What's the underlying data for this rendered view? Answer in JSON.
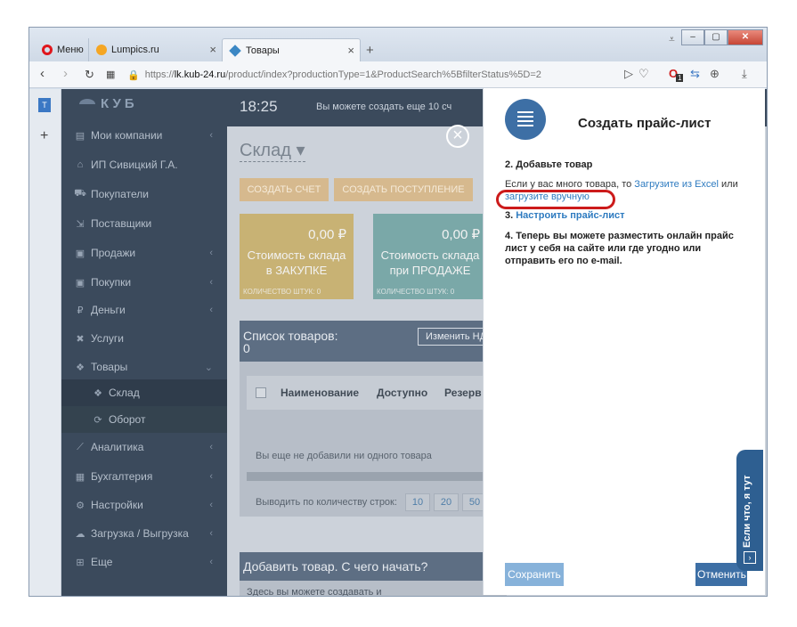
{
  "browser": {
    "tabs": [
      {
        "label": "Меню"
      },
      {
        "label": "Lumpics.ru"
      },
      {
        "label": "Товары"
      }
    ],
    "url": {
      "prefix": "https://",
      "host": "lk.kub-24.ru",
      "path": "/product/index?productionType=1&ProductSearch%5BfilterStatus%5D=2"
    },
    "badge_count": "1"
  },
  "sidebar": {
    "logo": "КУБ",
    "items": [
      {
        "label": "Мои компании",
        "icon": "briefcase-icon",
        "chevron": "‹"
      },
      {
        "label": "ИП Сивицкий Г.А.",
        "icon": "home-icon"
      },
      {
        "label": "Покупатели",
        "icon": "cart-icon"
      },
      {
        "label": "Поставщики",
        "icon": "trolley-icon"
      },
      {
        "label": "Продажи",
        "icon": "doc-icon",
        "chevron": "‹"
      },
      {
        "label": "Покупки",
        "icon": "doc-icon",
        "chevron": "‹"
      },
      {
        "label": "Деньги",
        "icon": "ruble-icon",
        "chevron": "‹"
      },
      {
        "label": "Услуги",
        "icon": "tools-icon"
      },
      {
        "label": "Товары",
        "icon": "boxes-icon",
        "chevron": "⌄"
      },
      {
        "label": "Склад",
        "icon": "boxes-icon"
      },
      {
        "label": "Оборот",
        "icon": "refresh-icon"
      },
      {
        "label": "Аналитика",
        "icon": "chart-icon",
        "chevron": "‹"
      },
      {
        "label": "Бухгалтерия",
        "icon": "ledger-icon",
        "chevron": "‹"
      },
      {
        "label": "Настройки",
        "icon": "gear-icon",
        "chevron": "‹"
      },
      {
        "label": "Загрузка / Выгрузка",
        "icon": "cloud-icon",
        "chevron": "‹"
      },
      {
        "label": "Еще",
        "icon": "plus-square-icon",
        "chevron": "‹"
      }
    ]
  },
  "topbar": {
    "time": "18:25",
    "notice": "Вы можете создать еще 10 сч"
  },
  "main": {
    "title": "Склад",
    "buttons": {
      "create_invoice": "СОЗДАТЬ СЧЕТ",
      "create_receipt": "СОЗДАТЬ ПОСТУПЛЕНИЕ"
    },
    "cards": [
      {
        "amount": "0,00 ₽",
        "line1": "Стоимость склада",
        "line2": "в ЗАКУПКЕ",
        "sub": "КОЛИЧЕСТВО ШТУК: 0"
      },
      {
        "amount": "0,00 ₽",
        "line1": "Стоимость склада",
        "line2": "при ПРОДАЖЕ",
        "sub": "КОЛИЧЕСТВО ШТУК: 0"
      }
    ],
    "list": {
      "title": "Список товаров:",
      "count": "0",
      "edit_button": "Изменить НД",
      "columns": [
        "Наименование",
        "Доступно",
        "Резерв"
      ],
      "empty": "Вы еще не добавили ни одного товара",
      "pager_label": "Выводить по количеству строк:",
      "pager": [
        "10",
        "20",
        "50"
      ]
    },
    "add_box": {
      "title": "Добавить товар. С чего начать?",
      "text": "Здесь вы можете создавать и редактировать товары."
    }
  },
  "modal": {
    "title": "Создать прайс-лист",
    "step2_title": "2. Добавьте товар",
    "step2_text_a": "Если у вас много товара, то ",
    "step2_link_excel": "Загрузите из Excel",
    "step2_text_b": " или ",
    "step2_link_manual": "загрузите вручную",
    "step3_num": "3. ",
    "step3_link": "Настроить прайс-лист",
    "step4_text": "4. Теперь вы можете разместить онлайн прайс лист у себя на сайте или где угодно или отправить его по e-mail.",
    "save": "Сохранить",
    "cancel": "Отменить"
  },
  "help_tab": {
    "label": "Если что, я тут"
  },
  "colors": {
    "accent": "#3d6fa5",
    "highlight": "#cc1b1b",
    "sidebar": "#3b4a5c"
  }
}
